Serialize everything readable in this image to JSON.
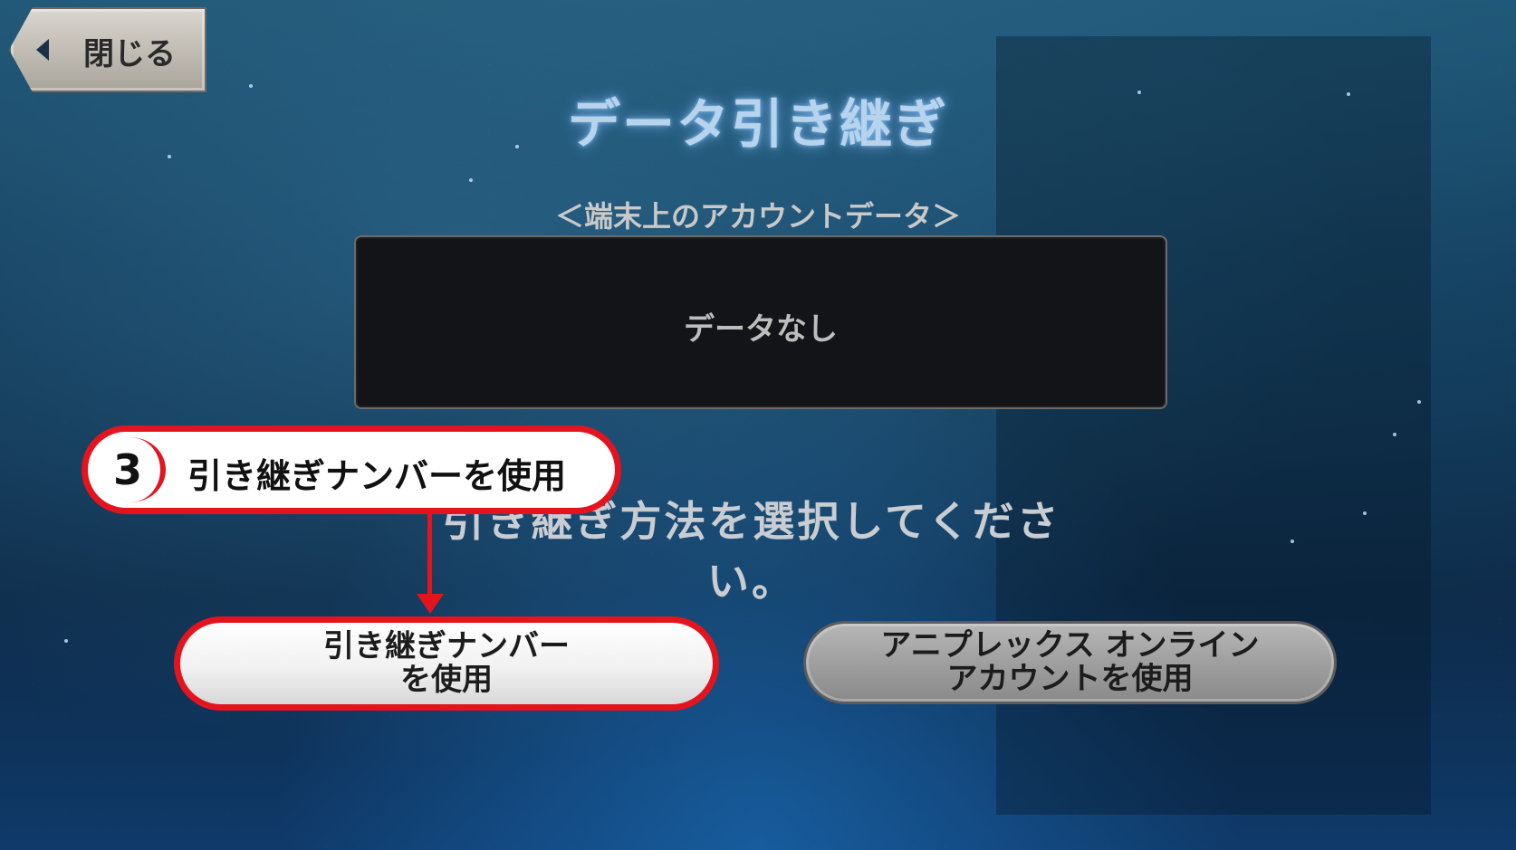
{
  "header": {
    "close_label": "閉じる",
    "title": "データ引き継ぎ"
  },
  "account_section": {
    "subtitle": "＜端末上のアカウントデータ＞",
    "empty_text": "データなし"
  },
  "instruction": "引き継ぎ方法を選択してください。",
  "callout": {
    "step": "3",
    "text": "引き継ぎナンバーを使用"
  },
  "buttons": {
    "primary_line1": "引き継ぎナンバー",
    "primary_line2": "を使用",
    "secondary_line1": "アニプレックス オンライン",
    "secondary_line2": "アカウントを使用"
  },
  "colors": {
    "highlight": "#e4141e",
    "title_glow": "#b8d3ec",
    "background": "#0b2a45"
  }
}
